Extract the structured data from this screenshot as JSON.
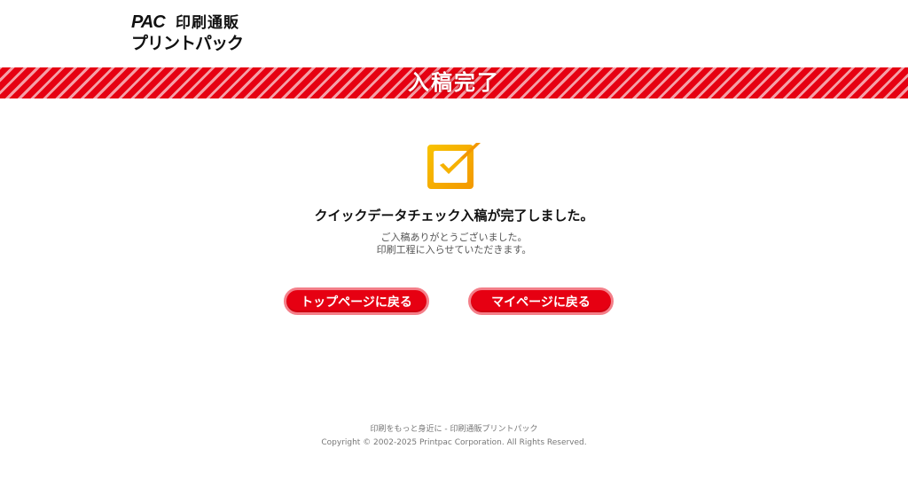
{
  "logo": {
    "brand_mark": "PAC",
    "top_text": "印刷通販",
    "bottom_text": "プリントパック"
  },
  "banner": {
    "title": "入稿完了"
  },
  "main": {
    "message": "クイックデータチェック入稿が完了しました。",
    "sub_line_1": "ご入稿ありがとうございました。",
    "sub_line_2": "印刷工程に入らせていただきます。"
  },
  "buttons": {
    "top_page": "トップページに戻る",
    "my_page": "マイページに戻る"
  },
  "footer": {
    "tagline": "印刷をもっと身近に - 印刷通販プリントパック",
    "copyright": "Copyright © 2002-2025 Printpac Corporation. All Rights Reserved."
  },
  "colors": {
    "accent_red": "#e60012",
    "stripe_light": "#f4a0a8",
    "check_orange": "#f39800",
    "check_yellow": "#f8c300"
  },
  "icons": {
    "check": "check-box-icon"
  }
}
